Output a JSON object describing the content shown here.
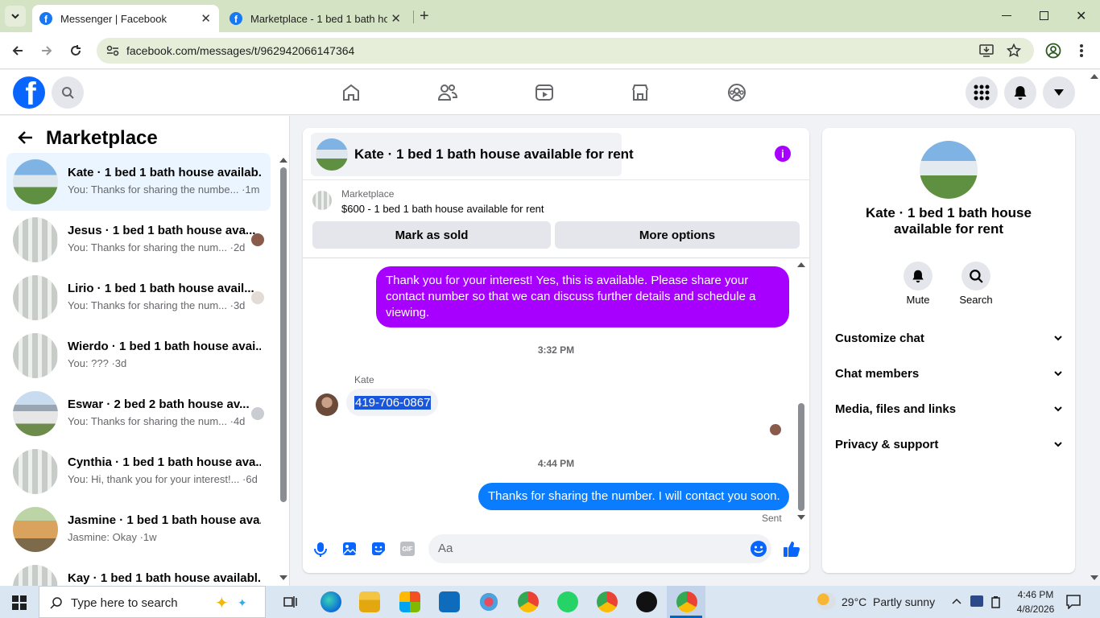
{
  "browser": {
    "tabs": [
      {
        "title": "Messenger | Facebook"
      },
      {
        "title": "Marketplace - 1 bed 1 bath hou"
      }
    ],
    "url": "facebook.com/messages/t/962942066147364"
  },
  "left_panel": {
    "title": "Marketplace",
    "conversations": [
      {
        "name": "Kate · 1 bed 1 bath house availab...",
        "preview": "You: Thanks for sharing the numbe... ·1m"
      },
      {
        "name": "Jesus · 1 bed 1 bath house ava...",
        "preview": "You: Thanks for sharing the num... ·2d"
      },
      {
        "name": "Lirio · 1 bed 1 bath house avail...",
        "preview": "You: Thanks for sharing the num... ·3d"
      },
      {
        "name": "Wierdo · 1 bed 1 bath house avai...",
        "preview": "You: ??? ·3d"
      },
      {
        "name": "Eswar · 2 bed 2 bath house av...",
        "preview": "You: Thanks for sharing the num... ·4d"
      },
      {
        "name": "Cynthia · 1 bed 1 bath house ava...",
        "preview": "You: Hi, thank you for your interest!... ·6d"
      },
      {
        "name": "Jasmine · 1 bed 1 bath house ava...",
        "preview": "Jasmine: Okay ·1w"
      },
      {
        "name": "Kay · 1 bed 1 bath house availabl...",
        "preview": ""
      }
    ]
  },
  "chat": {
    "title": "Kate · 1 bed 1 bath house available for rent",
    "listing_label": "Marketplace",
    "listing_price": "$600 - 1 bed 1 bath house available for rent",
    "mark_sold": "Mark as sold",
    "more_options": "More options",
    "messages": {
      "outgoing_1": "Thank you for your interest! Yes, this is available. Please share your contact number so that we can discuss further details and schedule a viewing.",
      "time_1": "3:32 PM",
      "sender": "Kate",
      "incoming_1": "419-706-0867",
      "time_2": "4:44 PM",
      "outgoing_2": "Thanks for sharing the number. I will contact you soon.",
      "status": "Sent"
    },
    "composer_placeholder": "Aa"
  },
  "info_panel": {
    "title": "Kate · 1 bed 1 bath house available for rent",
    "mute": "Mute",
    "search": "Search",
    "sections": [
      "Customize chat",
      "Chat members",
      "Media, files and links",
      "Privacy & support"
    ]
  },
  "taskbar": {
    "search_placeholder": "Type here to search",
    "weather": "29°C  Partly sunny",
    "time": "4:46 PM",
    "date": "4/8/2026"
  },
  "colors": {
    "fb_blue": "#0866ff",
    "purple": "#a700ff",
    "blue_bubble": "#0a7cff"
  }
}
